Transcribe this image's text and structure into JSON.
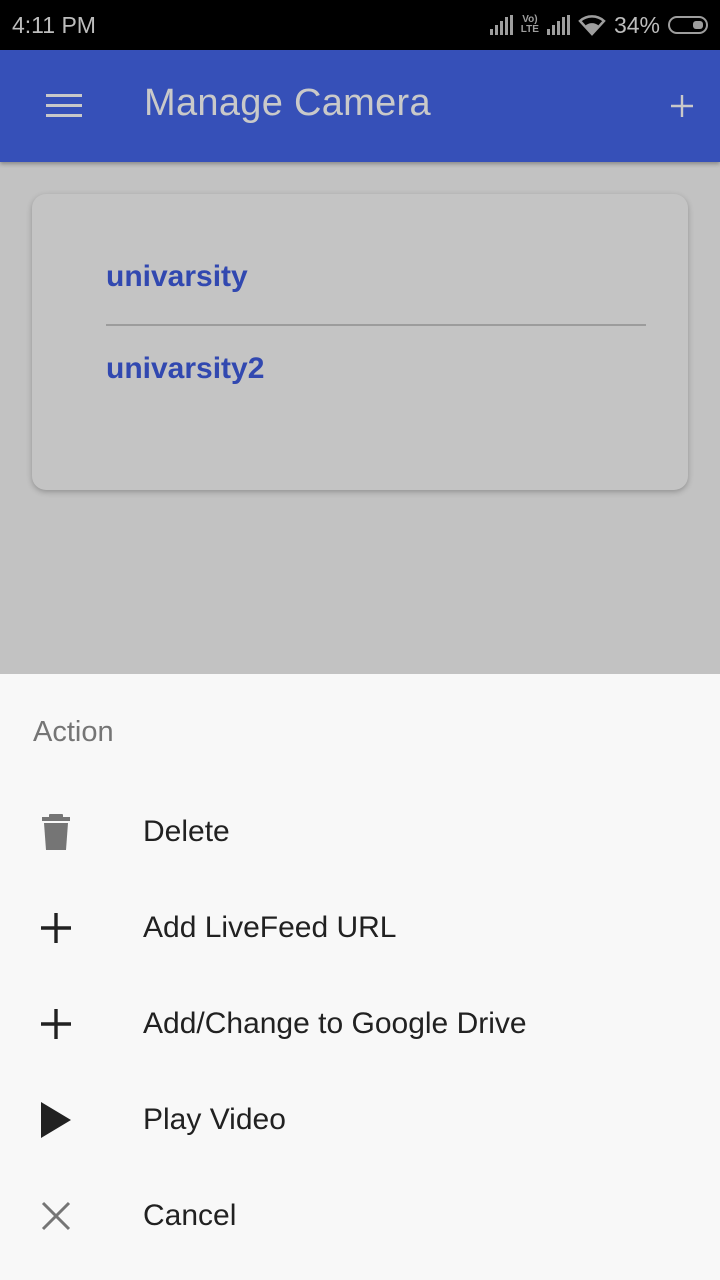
{
  "status_bar": {
    "time": "4:11 PM",
    "volte_top": "Vo)",
    "volte_bottom": "LTE",
    "battery_percent": "34%"
  },
  "app_bar": {
    "title": "Manage Camera",
    "menu_icon": "hamburger-menu-icon",
    "add_icon": "plus-icon"
  },
  "cameras": {
    "items": [
      {
        "label": "univarsity"
      },
      {
        "label": "univarsity2"
      }
    ]
  },
  "action_sheet": {
    "title": "Action",
    "actions": [
      {
        "label": "Delete",
        "icon": "trash-icon"
      },
      {
        "label": "Add LiveFeed URL",
        "icon": "plus-icon"
      },
      {
        "label": "Add/Change to Google Drive",
        "icon": "plus-icon"
      },
      {
        "label": "Play Video",
        "icon": "play-icon"
      },
      {
        "label": "Cancel",
        "icon": "close-icon"
      }
    ]
  },
  "colors": {
    "app_bar": "#3650b8",
    "camera_link": "#3148b0",
    "scrim": "#c2c2c2",
    "sheet": "#f8f8f8"
  }
}
